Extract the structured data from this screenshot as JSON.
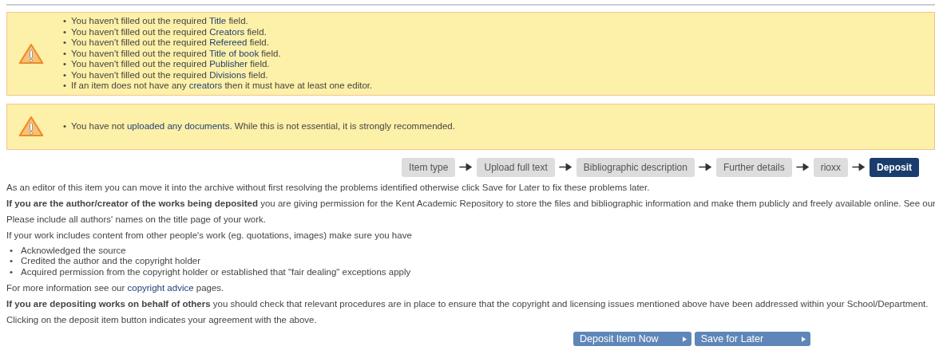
{
  "warnings": [
    {
      "bullet": "•",
      "items": [
        [
          {
            "kind": "plain",
            "text": "You haven't filled out the required "
          },
          {
            "kind": "link",
            "text": "Title"
          },
          {
            "kind": "plain",
            "text": " field."
          }
        ],
        [
          {
            "kind": "plain",
            "text": "You haven't filled out the required "
          },
          {
            "kind": "link",
            "text": "Creators"
          },
          {
            "kind": "plain",
            "text": " field."
          }
        ],
        [
          {
            "kind": "plain",
            "text": "You haven't filled out the required "
          },
          {
            "kind": "link",
            "text": "Refereed"
          },
          {
            "kind": "plain",
            "text": " field."
          }
        ],
        [
          {
            "kind": "plain",
            "text": "You haven't filled out the required "
          },
          {
            "kind": "link",
            "text": "Title of book"
          },
          {
            "kind": "plain",
            "text": " field."
          }
        ],
        [
          {
            "kind": "plain",
            "text": "You haven't filled out the required "
          },
          {
            "kind": "link",
            "text": "Publisher"
          },
          {
            "kind": "plain",
            "text": " field."
          }
        ],
        [
          {
            "kind": "plain",
            "text": "You haven't filled out the required "
          },
          {
            "kind": "link",
            "text": "Divisions"
          },
          {
            "kind": "plain",
            "text": " field."
          }
        ],
        [
          {
            "kind": "plain",
            "text": "If an item does not have any "
          },
          {
            "kind": "link",
            "text": "creators"
          },
          {
            "kind": "plain",
            "text": " then it must have at least one editor."
          }
        ]
      ]
    },
    {
      "bullet": "•",
      "items": [
        [
          {
            "kind": "plain",
            "text": "You have not "
          },
          {
            "kind": "link",
            "text": "uploaded any documents"
          },
          {
            "kind": "plain",
            "text": ". While this is not essential, it is strongly recommended."
          }
        ]
      ]
    }
  ],
  "steps": [
    {
      "label": "Item type",
      "selected": false
    },
    {
      "label": "Upload full text",
      "selected": false
    },
    {
      "label": "Bibliographic description",
      "selected": false
    },
    {
      "label": "Further details",
      "selected": false
    },
    {
      "label": "rioxx",
      "selected": false
    },
    {
      "label": "Deposit",
      "selected": true
    }
  ],
  "content": [
    {
      "kind": "paragraph",
      "parts": [
        {
          "kind": "plain",
          "text": "As an editor of this item you can move it into the archive without first resolving the problems identified otherwise click Save for Later to fix these problems later."
        }
      ]
    },
    {
      "kind": "paragraph",
      "parts": [
        {
          "kind": "bold",
          "text": "If you are the author/creator of the works being deposited"
        },
        {
          "kind": "plain",
          "text": " you are giving permission for the Kent Academic Repository to store the files and bibliographic information and make them publicly and freely available online. See our"
        }
      ]
    },
    {
      "kind": "paragraph",
      "parts": [
        {
          "kind": "plain",
          "text": "Please include all authors' names on the title page of your work."
        }
      ]
    },
    {
      "kind": "paragraph",
      "parts": [
        {
          "kind": "plain",
          "text": "If your work includes content from other people's work (eg. quotations, images) make sure you have"
        }
      ]
    },
    {
      "kind": "list",
      "bullet": "•",
      "items": [
        "Acknowledged the source",
        "Credited the author and the copyright holder",
        "Acquired permission from the copyright holder or established that \"fair dealing\" exceptions apply"
      ]
    },
    {
      "kind": "paragraph",
      "parts": [
        {
          "kind": "plain",
          "text": "For more information see our "
        },
        {
          "kind": "link",
          "text": "copyright advice"
        },
        {
          "kind": "plain",
          "text": " pages."
        }
      ]
    },
    {
      "kind": "paragraph",
      "parts": [
        {
          "kind": "bold",
          "text": "If you are depositing works on behalf of others"
        },
        {
          "kind": "plain",
          "text": " you should check that relevant procedures are in place to ensure that the copyright and licensing issues mentioned above have been addressed within your School/Department."
        }
      ]
    },
    {
      "kind": "paragraph",
      "parts": [
        {
          "kind": "plain",
          "text": "Clicking on the deposit item button indicates your agreement with the above."
        }
      ]
    }
  ],
  "buttons": [
    "Deposit Item Now",
    "Save for Later"
  ]
}
